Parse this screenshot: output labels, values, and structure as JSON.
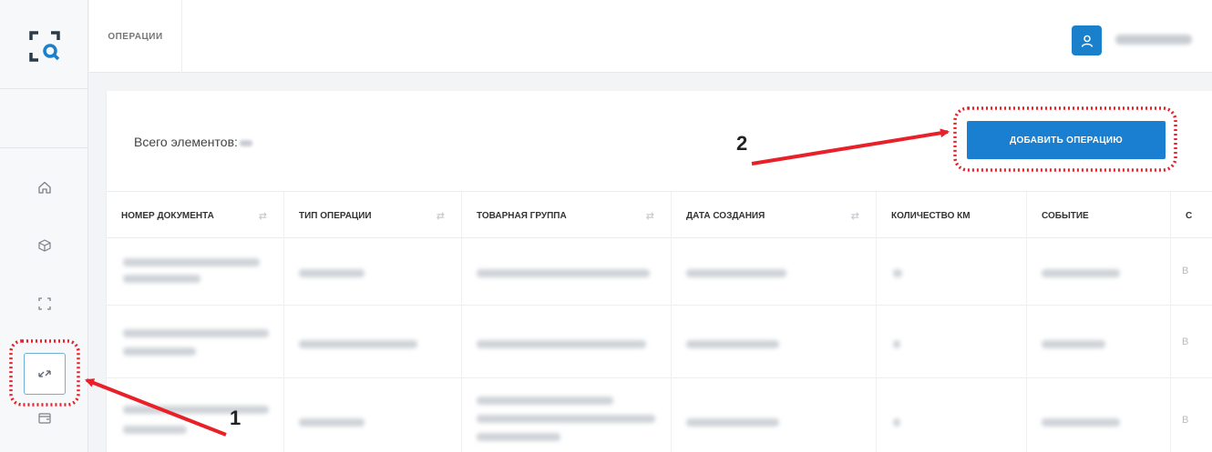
{
  "header": {
    "tab_label": "ОПЕРАЦИИ",
    "accent_color": "#1a80cc"
  },
  "sidebar": {
    "items": [
      {
        "icon": "home-icon"
      },
      {
        "icon": "box-icon"
      },
      {
        "icon": "scan-icon"
      },
      {
        "icon": "exchange-icon",
        "active": true
      },
      {
        "icon": "wallet-icon"
      }
    ]
  },
  "main": {
    "total_label": "Всего элементов:",
    "add_button_label": "ДОБАВИТЬ ОПЕРАЦИЮ",
    "columns": [
      {
        "label": "НОМЕР ДОКУМЕНТА",
        "sortable": true
      },
      {
        "label": "ТИП ОПЕРАЦИИ",
        "sortable": true
      },
      {
        "label": "ТОВАРНАЯ ГРУППА",
        "sortable": true
      },
      {
        "label": "ДАТА СОЗДАНИЯ",
        "sortable": true
      },
      {
        "label": "КОЛИЧЕСТВО КМ",
        "sortable": false
      },
      {
        "label": "СОБЫТИЕ",
        "sortable": false
      },
      {
        "label": "С",
        "sortable": false
      }
    ],
    "rows_cut_text": [
      "В",
      "В",
      "В"
    ]
  },
  "annotations": {
    "marker_1": "1",
    "marker_2": "2",
    "highlight_color": "#e8202a"
  }
}
